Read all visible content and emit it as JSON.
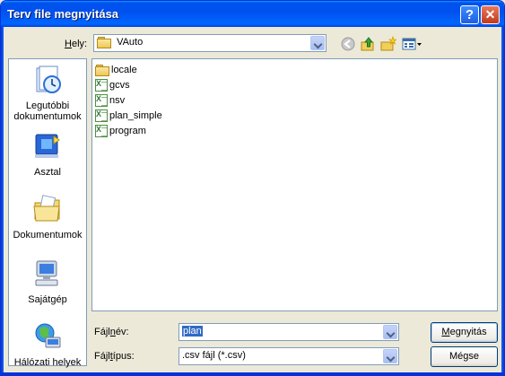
{
  "window": {
    "title": "Terv file megnyitása",
    "help_glyph": "?",
    "close_glyph": "✕"
  },
  "lookin": {
    "label_accel": "H",
    "label_rest": "ely:",
    "value": "VAuto"
  },
  "toolbar": {
    "icons": [
      "back-icon",
      "up-folder-icon",
      "new-folder-icon",
      "view-menu-icon"
    ]
  },
  "places": [
    {
      "label": "Legutóbbi dokumentumok",
      "icon": "recent-documents-icon"
    },
    {
      "label": "Asztal",
      "icon": "desktop-icon"
    },
    {
      "label": "Dokumentumok",
      "icon": "my-documents-icon"
    },
    {
      "label": "Sajátgép",
      "icon": "my-computer-icon"
    },
    {
      "label": "Hálózati helyek",
      "icon": "network-places-icon"
    }
  ],
  "files": [
    {
      "name": "locale",
      "type": "folder"
    },
    {
      "name": "gcvs",
      "type": "csv"
    },
    {
      "name": "nsv",
      "type": "csv"
    },
    {
      "name": "plan_simple",
      "type": "csv"
    },
    {
      "name": "program",
      "type": "csv"
    }
  ],
  "filename": {
    "label_pre": "Fájl",
    "label_accel": "n",
    "label_post": "év:",
    "value": "plan"
  },
  "filetype": {
    "label_pre": "Fájl",
    "label_accel": "t",
    "label_post": "ípus:",
    "value": ".csv fájl (*.csv)"
  },
  "buttons": {
    "open_pre": "",
    "open_accel": "M",
    "open_post": "egnyitás",
    "cancel": "Mégse"
  },
  "colors": {
    "titlebar": "#0053ee",
    "selection": "#316ac5",
    "dialog_bg": "#ece9d8"
  }
}
